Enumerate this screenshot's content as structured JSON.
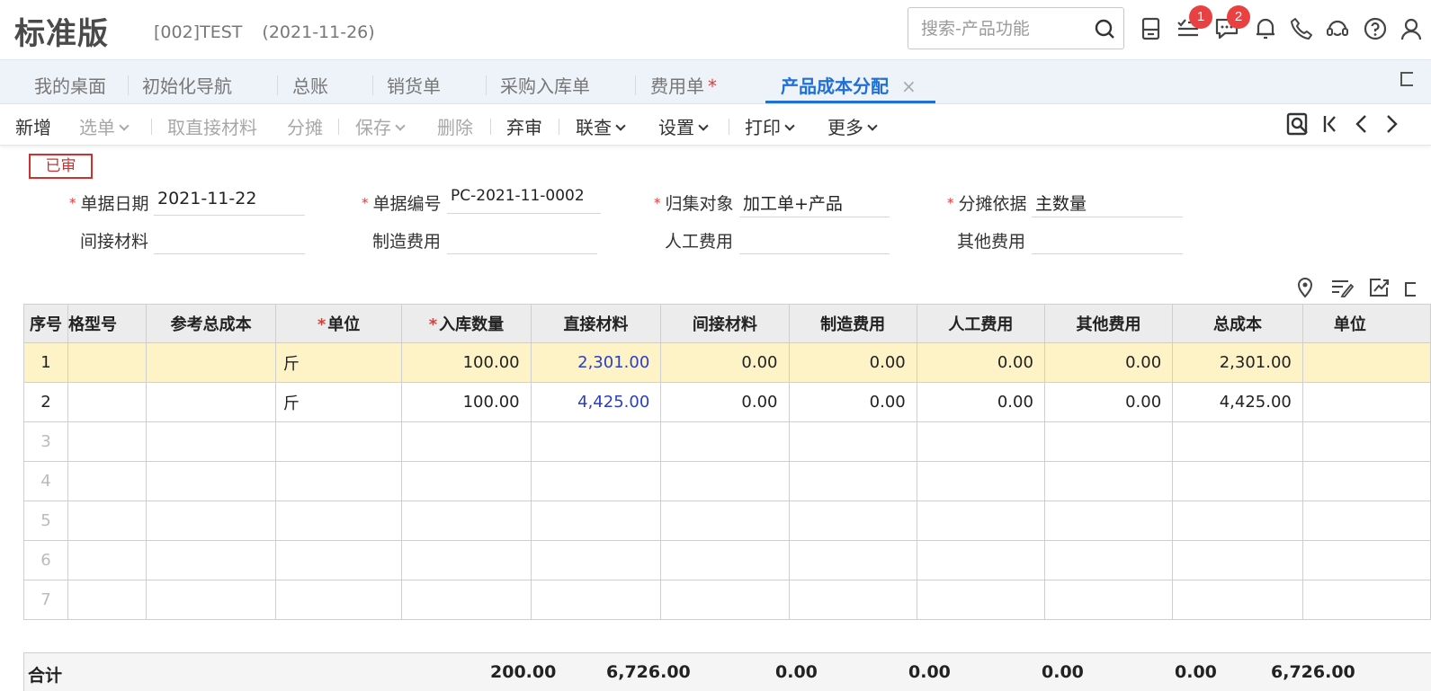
{
  "header": {
    "brand": "标准版",
    "account_code": "[002]TEST",
    "account_date": "(2021-11-26)",
    "search_placeholder": "搜索-产品功能",
    "badges": {
      "tasks": "1",
      "messages": "2"
    }
  },
  "tabs": [
    {
      "label": "我的桌面"
    },
    {
      "label": "初始化导航"
    },
    {
      "label": "总账"
    },
    {
      "label": "销货单"
    },
    {
      "label": "采购入库单"
    },
    {
      "label": "费用单",
      "modified_mark": "*"
    },
    {
      "label": "产品成本分配",
      "active": true,
      "close": "×"
    }
  ],
  "toolbar": {
    "new": "新增",
    "select": "选单",
    "fetch_direct_material": "取直接材料",
    "allocate": "分摊",
    "save": "保存",
    "delete": "删除",
    "unapprove": "弃审",
    "query": "联查",
    "settings": "设置",
    "print": "打印",
    "more": "更多"
  },
  "form": {
    "status_stamp": "已审",
    "required_mark": "*",
    "fields": {
      "doc_date": {
        "label": "单据日期",
        "value": "2021-11-22"
      },
      "doc_no": {
        "label": "单据编号",
        "value": "PC-2021-11-0002"
      },
      "collect_object": {
        "label": "归集对象",
        "value": "加工单+产品"
      },
      "alloc_basis": {
        "label": "分摊依据",
        "value": "主数量"
      },
      "indirect_material": {
        "label": "间接材料",
        "value": ""
      },
      "manufacturing_cost": {
        "label": "制造费用",
        "value": ""
      },
      "labor_cost": {
        "label": "人工费用",
        "value": ""
      },
      "other_cost": {
        "label": "其他费用",
        "value": ""
      }
    }
  },
  "grid": {
    "columns": {
      "seq": "序号",
      "spec": "格型号",
      "ref_total": "参考总成本",
      "unit": "单位",
      "in_qty": "入库数量",
      "direct_material": "直接材料",
      "indirect_material": "间接材料",
      "manufacturing": "制造费用",
      "labor": "人工费用",
      "other": "其他费用",
      "total_cost": "总成本",
      "unit_cost": "单位"
    },
    "rows": [
      {
        "seq": "1",
        "unit": "斤",
        "in_qty": "100.00",
        "direct_material": "2,301.00",
        "indirect_material": "0.00",
        "manufacturing": "0.00",
        "labor": "0.00",
        "other": "0.00",
        "total_cost": "2,301.00"
      },
      {
        "seq": "2",
        "unit": "斤",
        "in_qty": "100.00",
        "direct_material": "4,425.00",
        "indirect_material": "0.00",
        "manufacturing": "0.00",
        "labor": "0.00",
        "other": "0.00",
        "total_cost": "4,425.00"
      },
      {
        "seq": "3"
      },
      {
        "seq": "4"
      },
      {
        "seq": "5"
      },
      {
        "seq": "6"
      },
      {
        "seq": "7"
      }
    ],
    "totals": {
      "label": "合计",
      "in_qty": "200.00",
      "direct_material": "6,726.00",
      "indirect_material": "0.00",
      "manufacturing": "0.00",
      "labor": "0.00",
      "other": "0.00",
      "total_cost": "6,726.00"
    }
  }
}
